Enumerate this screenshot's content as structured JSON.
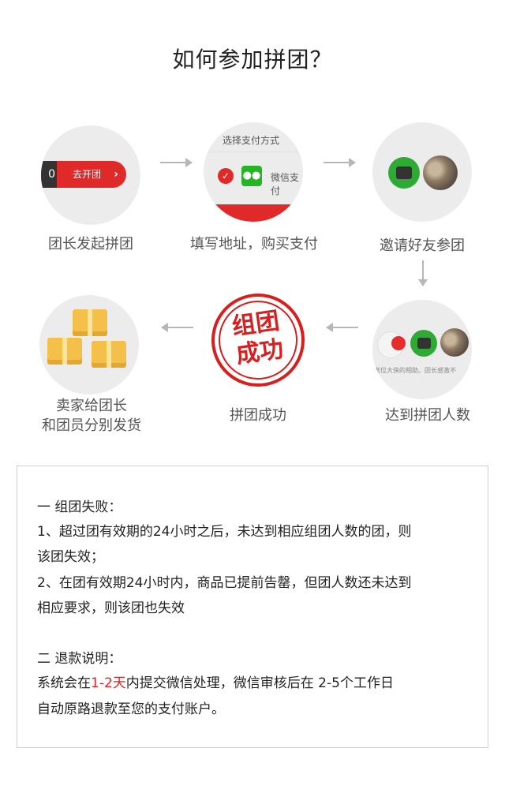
{
  "title": "如何参加拼团？",
  "steps": [
    {
      "label": "团长发起拼团",
      "button_text": "去开团",
      "digit": "0",
      "chevron": "›"
    },
    {
      "label": "填写地址，购买支付",
      "pay_header": "选择支付方式",
      "pay_method": "微信支付"
    },
    {
      "label": "邀请好友参团"
    },
    {
      "label": "达到拼团人数",
      "small_text": "者位大侠的相助。团长感激不"
    },
    {
      "label": "拼团成功",
      "stamp_line1": "组团",
      "stamp_line2": "成功"
    },
    {
      "label_line1": "卖家给团长",
      "label_line2": "和团员分别发货"
    }
  ],
  "info": {
    "fail_title": "一  组团失败：",
    "fail_1_line1": "1、超过团有效期的24小时之后，未达到相应组团人数的团，则",
    "fail_1_line2": "该团失效；",
    "fail_2_line1": "2、在团有效期24小时内，商品已提前告罄，但团人数还未达到",
    "fail_2_line2": "相应要求，则该团也失效",
    "refund_title": "二  退款说明：",
    "refund_pre": "系统会在",
    "refund_highlight": "1-2天",
    "refund_post": "内提交微信处理，微信审核后在 2-5个工作日",
    "refund_line2": "自动原路退款至您的支付账户。"
  },
  "colors": {
    "accent_red": "#e02a2a",
    "wechat_green": "#23b523",
    "arrow_grey": "#b7b7b7"
  }
}
